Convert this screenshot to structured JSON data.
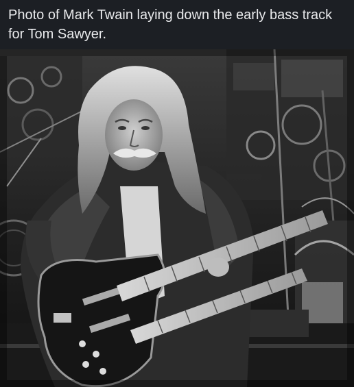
{
  "post": {
    "caption": "Photo of Mark Twain laying down the early bass track for Tom Sawyer.",
    "image": {
      "kind": "black-and-white photograph",
      "subject": "long-haired man with white hair and moustache playing a double-neck bass guitar on stage"
    }
  },
  "colors": {
    "background": "#1c1f24",
    "caption_text": "#e9eaec"
  }
}
